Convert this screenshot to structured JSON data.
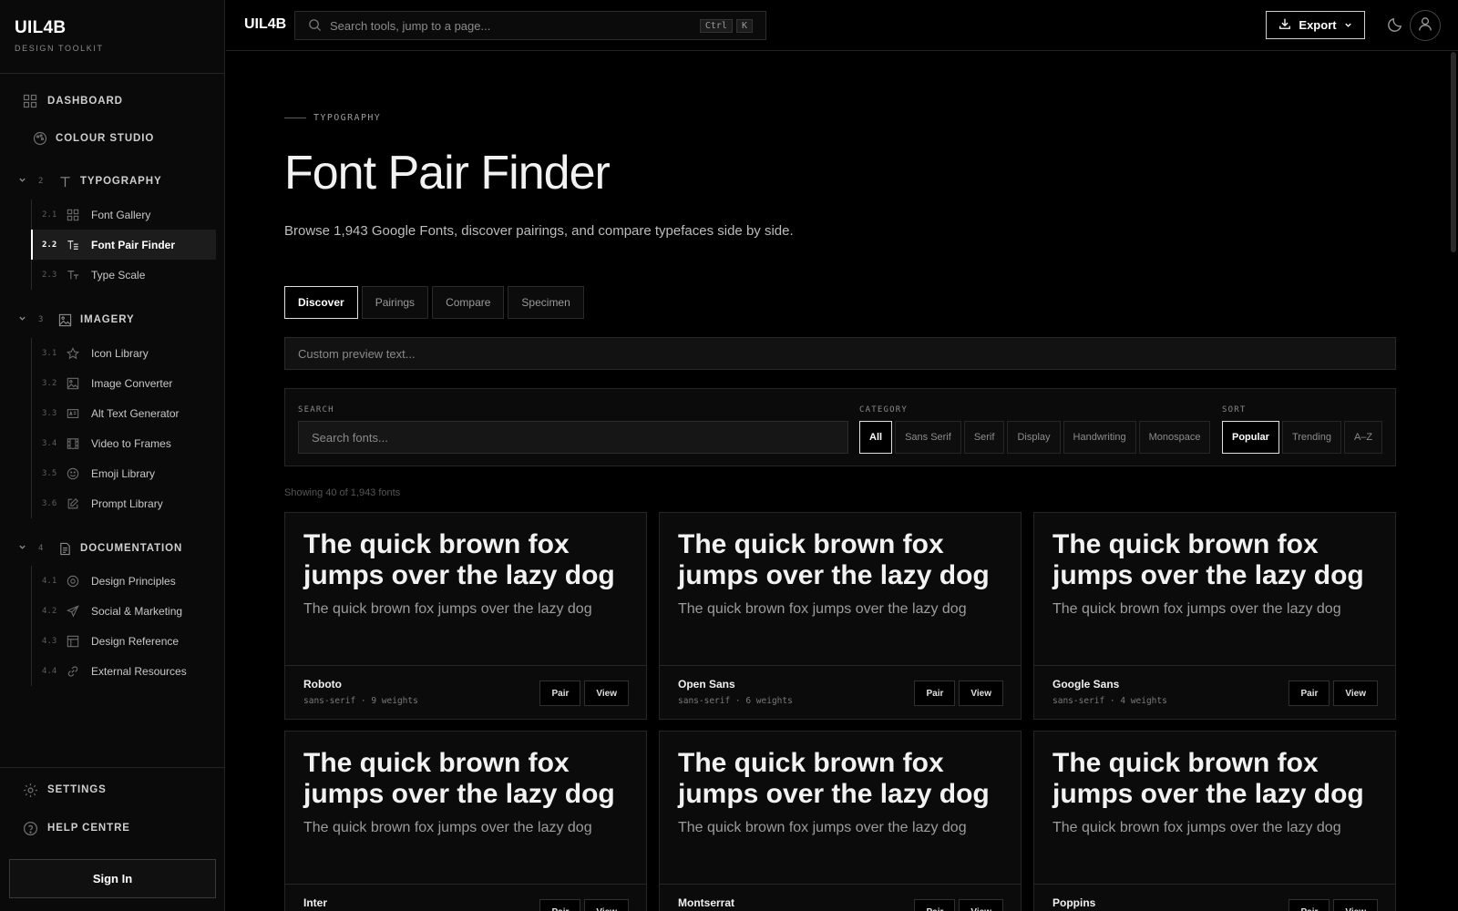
{
  "brand": {
    "name": "UIL4B",
    "subtitle": "DESIGN TOOLKIT"
  },
  "sidebar": {
    "top": [
      {
        "label": "DASHBOARD"
      },
      {
        "label": "COLOUR STUDIO"
      }
    ],
    "sections": [
      {
        "num": "2",
        "label": "TYPOGRAPHY",
        "items": [
          {
            "num": "2.1",
            "label": "Font Gallery"
          },
          {
            "num": "2.2",
            "label": "Font Pair Finder",
            "active": true
          },
          {
            "num": "2.3",
            "label": "Type Scale"
          }
        ]
      },
      {
        "num": "3",
        "label": "IMAGERY",
        "items": [
          {
            "num": "3.1",
            "label": "Icon Library"
          },
          {
            "num": "3.2",
            "label": "Image Converter"
          },
          {
            "num": "3.3",
            "label": "Alt Text Generator"
          },
          {
            "num": "3.4",
            "label": "Video to Frames"
          },
          {
            "num": "3.5",
            "label": "Emoji Library"
          },
          {
            "num": "3.6",
            "label": "Prompt Library"
          }
        ]
      },
      {
        "num": "4",
        "label": "DOCUMENTATION",
        "items": [
          {
            "num": "4.1",
            "label": "Design Principles"
          },
          {
            "num": "4.2",
            "label": "Social & Marketing"
          },
          {
            "num": "4.3",
            "label": "Design Reference"
          },
          {
            "num": "4.4",
            "label": "External Resources"
          }
        ]
      }
    ],
    "bottom": [
      {
        "label": "SETTINGS"
      },
      {
        "label": "HELP CENTRE"
      }
    ],
    "sign_in": "Sign In"
  },
  "header": {
    "logo": "UIL4B",
    "search_placeholder": "Search tools, jump to a page...",
    "shortcut": [
      "Ctrl",
      "K"
    ],
    "export_label": "Export"
  },
  "main": {
    "eyebrow": "TYPOGRAPHY",
    "title": "Font Pair Finder",
    "description": "Browse 1,943 Google Fonts, discover pairings, and compare typefaces side by side.",
    "tabs": [
      {
        "label": "Discover",
        "active": true
      },
      {
        "label": "Pairings"
      },
      {
        "label": "Compare"
      },
      {
        "label": "Specimen"
      }
    ],
    "preview_placeholder": "Custom preview text...",
    "filters": {
      "search_label": "SEARCH",
      "search_placeholder": "Search fonts...",
      "category_label": "CATEGORY",
      "categories": [
        {
          "label": "All",
          "active": true
        },
        {
          "label": "Sans Serif"
        },
        {
          "label": "Serif"
        },
        {
          "label": "Display"
        },
        {
          "label": "Handwriting"
        },
        {
          "label": "Monospace"
        }
      ],
      "sort_label": "SORT",
      "sorts": [
        {
          "label": "Popular",
          "active": true
        },
        {
          "label": "Trending"
        },
        {
          "label": "A–Z"
        }
      ]
    },
    "showing": "Showing 40 of 1,943 fonts",
    "preview_text": "The quick brown fox jumps over the lazy dog",
    "pair_label": "Pair",
    "view_label": "View",
    "fonts": [
      {
        "name": "Roboto",
        "meta": "sans-serif · 9 weights"
      },
      {
        "name": "Open Sans",
        "meta": "sans-serif · 6 weights"
      },
      {
        "name": "Google Sans",
        "meta": "sans-serif · 4 weights"
      },
      {
        "name": "Inter",
        "meta": ""
      },
      {
        "name": "Montserrat",
        "meta": ""
      },
      {
        "name": "Poppins",
        "meta": ""
      }
    ]
  }
}
